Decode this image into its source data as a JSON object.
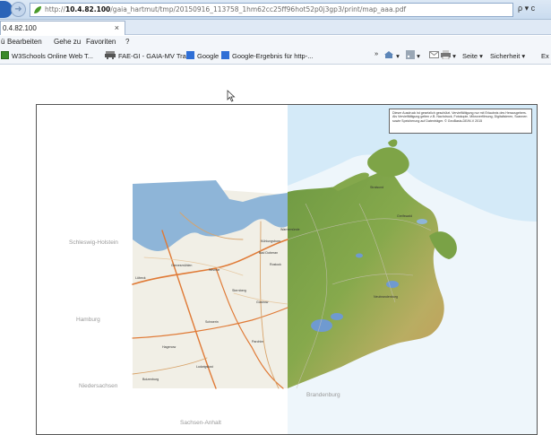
{
  "browser": {
    "url": {
      "scheme": "http://",
      "host": "10.4.82.100",
      "path": "/gaia_hartmut/tmp/20150916_113758_1hm62cc25ff96hot52p0j3gp3/print/map_aaa.pdf",
      "right_controls": "ρ ▾ c"
    },
    "tab": {
      "label": "0.4.82.100",
      "close": "×"
    },
    "menu": {
      "items": [
        "ü",
        "Bearbeiten",
        "Gehe zu",
        "Favoriten",
        "?"
      ]
    },
    "favorites": [
      {
        "label": "W3Schools Online Web T...",
        "icon": "ie-page-icon"
      },
      {
        "label": "FAE-GI - GAIA-MV Trac",
        "icon": "trac-icon"
      },
      {
        "label": "Google",
        "icon": "google-icon"
      },
      {
        "label": "Google-Ergebnis für http-...",
        "icon": "google-icon"
      }
    ],
    "toolbar": {
      "chevron": "»",
      "seite": "Seite ▾",
      "sicherheit": "Sicherheit ▾",
      "extras": "Ex"
    }
  },
  "map": {
    "info_text": "Dieser Ausdruck ist gesetzlich geschützt. Vervielfältigung nur mit Erlaubnis des Herausgebers. Als Vervielfältigung gelten z.B. Nachdruck, Fotokopie, Mikroverfilmung, Digitalisieren, Scannen sowie Speicherung auf Datenträger. © GeoBasis-DE/M-V 2015",
    "regions": {
      "schleswig_holstein": "Schleswig-Holstein",
      "hamburg": "Hamburg",
      "niedersachsen": "Niedersachsen",
      "brandenburg": "Brandenburg",
      "sachsen_anhalt": "Sachsen-Anhalt"
    },
    "cities": {
      "rostock": "Rostock",
      "wismar": "Wismar",
      "schwerin": "Schwerin",
      "luebeck": "Lübeck",
      "guestrow": "Güstrow",
      "kuehlungsborn": "Kühlungsborn",
      "bad_doberan": "Bad Doberan",
      "grevesmuehlen": "Grevesmühlen",
      "hagenow": "Hagenow",
      "parchim": "Parchim",
      "ludwigslust": "Ludwigslust",
      "boizenburg": "Boizenburg",
      "sternberg": "Sternberg",
      "warnemuende": "Warnemünde",
      "neubrandenburg": "Neubrandenburg",
      "stralsund": "Stralsund",
      "greifswald": "Greifswald"
    }
  }
}
